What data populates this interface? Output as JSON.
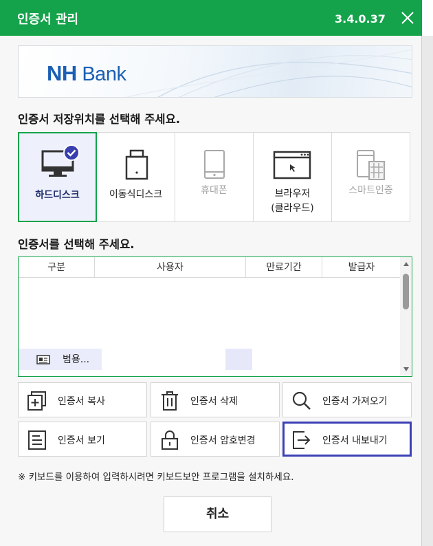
{
  "window": {
    "title": "인증서 관리",
    "version": "3.4.0.37"
  },
  "banner": {
    "logo_nh": "NH",
    "logo_bank": "Bank"
  },
  "storage": {
    "heading": "인증서 저장위치를 선택해 주세요.",
    "options": [
      {
        "label": "하드디스크",
        "icon": "monitor-icon",
        "state": "selected"
      },
      {
        "label": "이동식디스크",
        "icon": "usb-drive-icon",
        "state": "enabled"
      },
      {
        "label": "휴대폰",
        "icon": "phone-icon",
        "state": "disabled"
      },
      {
        "label_line1": "브라우저",
        "label_line2": "(클라우드)",
        "icon": "browser-window-icon",
        "state": "enabled"
      },
      {
        "label": "스마트인증",
        "icon": "smart-auth-icon",
        "state": "disabled"
      }
    ]
  },
  "cert_list": {
    "heading": "인증서를 선택해 주세요.",
    "columns": [
      "구분",
      "사용자",
      "만료기간",
      "발급자"
    ],
    "rows": [
      {
        "type": "범용...",
        "user": "",
        "expiry": "",
        "issuer": ""
      }
    ]
  },
  "actions": {
    "copy": "인증서 복사",
    "delete": "인증서 삭제",
    "import": "인증서 가져오기",
    "view": "인증서 보기",
    "change_password": "인증서 암호변경",
    "export": "인증서 내보내기"
  },
  "notice": "※ 키보드를 이용하여 입력하시려면 키보드보안 프로그램을 설치하세요.",
  "cancel_label": "취소",
  "colors": {
    "titlebar": "#14a34a",
    "selected_border": "#14a34a",
    "focus_border": "#3c40b5",
    "brand_blue": "#1a5fb4",
    "check_badge": "#3a3fb0"
  }
}
